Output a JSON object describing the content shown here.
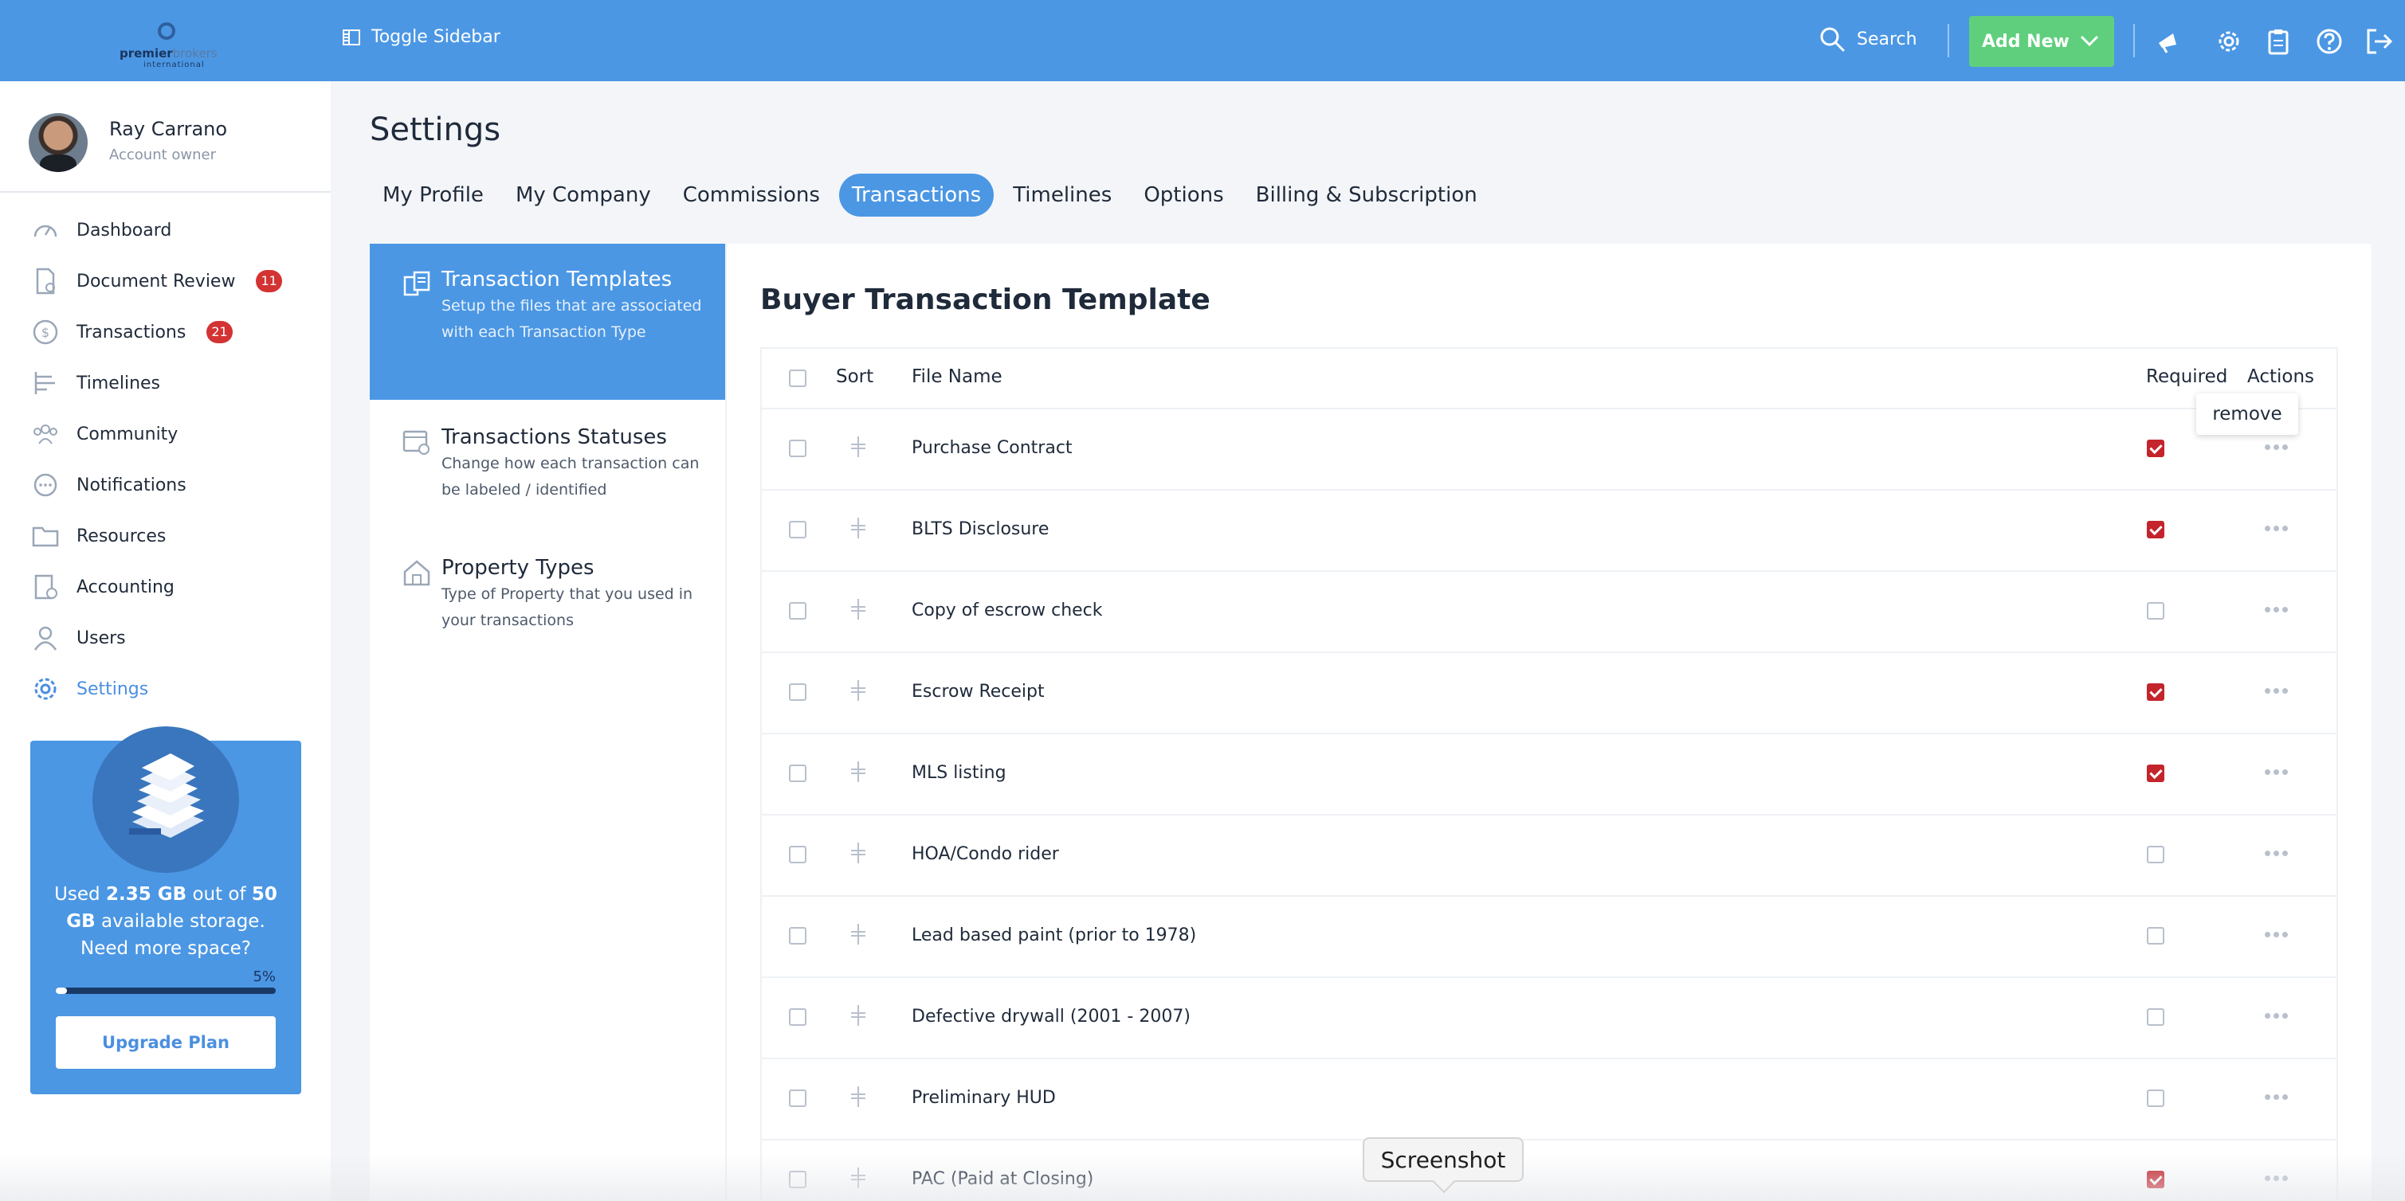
{
  "topbar": {
    "logo": {
      "brand_bold": "premier",
      "brand_light": "brokers",
      "sub": "international"
    },
    "toggle_label": "Toggle Sidebar",
    "search_label": "Search",
    "add_new_label": "Add New",
    "icons": [
      "megaphone-icon",
      "gear-icon",
      "clipboard-icon",
      "help-icon",
      "logout-icon"
    ],
    "color": "#4b97e4"
  },
  "user": {
    "name": "Ray Carrano",
    "role": "Account owner"
  },
  "sidebar": {
    "items": [
      {
        "label": "Dashboard",
        "icon": "dashboard-icon",
        "badge": null
      },
      {
        "label": "Document Review",
        "icon": "document-review-icon",
        "badge": "11"
      },
      {
        "label": "Transactions",
        "icon": "transactions-icon",
        "badge": "21"
      },
      {
        "label": "Timelines",
        "icon": "timelines-icon",
        "badge": null
      },
      {
        "label": "Community",
        "icon": "community-icon",
        "badge": null
      },
      {
        "label": "Notifications",
        "icon": "notifications-icon",
        "badge": null
      },
      {
        "label": "Resources",
        "icon": "resources-icon",
        "badge": null
      },
      {
        "label": "Accounting",
        "icon": "accounting-icon",
        "badge": null
      },
      {
        "label": "Users",
        "icon": "users-icon",
        "badge": null
      },
      {
        "label": "Settings",
        "icon": "settings-icon",
        "badge": null,
        "active": true
      }
    ]
  },
  "storage": {
    "text_used": "Used",
    "used": "2.35 GB",
    "text_out_of": "out of",
    "total": "50 GB",
    "text_available": "available storage.",
    "text_more": "Need more space?",
    "percent_label": "5%",
    "percent": 5,
    "upgrade_label": "Upgrade Plan"
  },
  "page": {
    "title": "Settings"
  },
  "tabs": [
    {
      "label": "My Profile"
    },
    {
      "label": "My Company"
    },
    {
      "label": "Commissions"
    },
    {
      "label": "Transactions",
      "active": true
    },
    {
      "label": "Timelines"
    },
    {
      "label": "Options"
    },
    {
      "label": "Billing & Subscription"
    }
  ],
  "subnav": [
    {
      "title": "Transaction Templates",
      "desc": "Setup the files that are associated with each Transaction Type",
      "active": true
    },
    {
      "title": "Transactions Statuses",
      "desc": "Change how each transaction can be labeled / identified"
    },
    {
      "title": "Property Types",
      "desc": "Type of Property that you used in your transactions"
    }
  ],
  "content": {
    "title": "Buyer Transaction Template",
    "columns": {
      "sort": "Sort",
      "file_name": "File Name",
      "required": "Required",
      "actions": "Actions"
    },
    "popup_label": "remove",
    "rows": [
      {
        "name": "Purchase Contract",
        "required": true
      },
      {
        "name": "BLTS Disclosure",
        "required": true
      },
      {
        "name": "Copy of escrow check",
        "required": false
      },
      {
        "name": "Escrow Receipt",
        "required": true
      },
      {
        "name": "MLS listing",
        "required": true
      },
      {
        "name": "HOA/Condo rider",
        "required": false
      },
      {
        "name": "Lead based paint (prior to 1978)",
        "required": false
      },
      {
        "name": "Defective drywall (2001 - 2007)",
        "required": false
      },
      {
        "name": "Preliminary HUD",
        "required": false
      },
      {
        "name": "PAC (Paid at Closing)",
        "required": true
      }
    ]
  },
  "tooltip": "Screenshot",
  "colors": {
    "accent": "#4b97e4",
    "add_new": "#5fcf7d",
    "badge": "#d33333",
    "checked": "#c4242c"
  }
}
